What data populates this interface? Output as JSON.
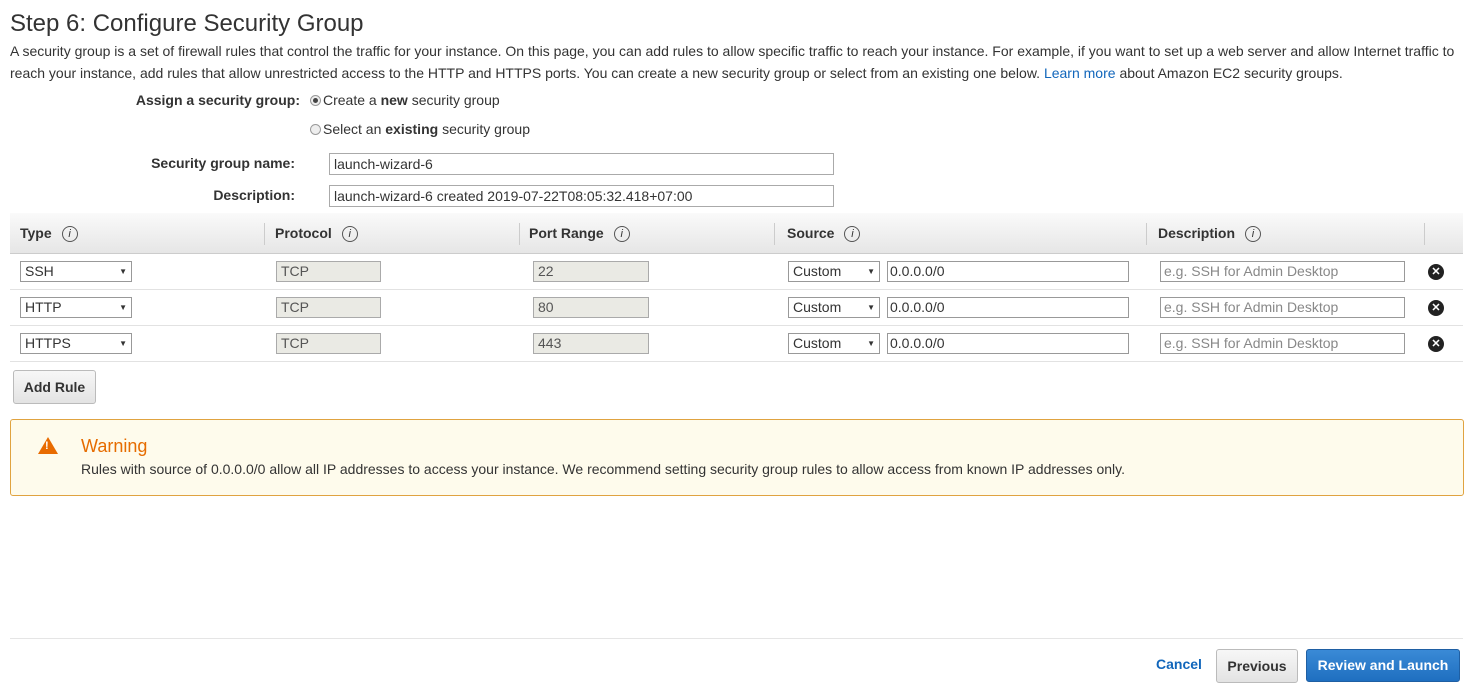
{
  "page": {
    "title": "Step 6: Configure Security Group",
    "intro_text": "A security group is a set of firewall rules that control the traffic for your instance. On this page, you can add rules to allow specific traffic to reach your instance. For example, if you want to set up a web server and allow Internet traffic to reach your instance, add rules that allow unrestricted access to the HTTP and HTTPS ports. You can create a new security group or select from an existing one below.",
    "learn_more": "Learn more",
    "intro_suffix": "about Amazon EC2 security groups."
  },
  "assign": {
    "label": "Assign a security group:",
    "option_new_pre": "Create a",
    "option_new_bold": "new",
    "option_new_post": "security group",
    "option_existing_pre": "Select an",
    "option_existing_bold": "existing",
    "option_existing_post": "security group",
    "selected": "new"
  },
  "group": {
    "name_label": "Security group name:",
    "name_value": "launch-wizard-6",
    "desc_label": "Description:",
    "desc_value": "launch-wizard-6 created 2019-07-22T08:05:32.418+07:00"
  },
  "table": {
    "headers": [
      "Type",
      "Protocol",
      "Port Range",
      "Source",
      "Description"
    ],
    "info_glyph": "i",
    "rows": [
      {
        "type": "SSH",
        "protocol": "TCP",
        "port": "22",
        "source_mode": "Custom",
        "source_cidr": "0.0.0.0/0",
        "desc_placeholder": "e.g. SSH for Admin Desktop"
      },
      {
        "type": "HTTP",
        "protocol": "TCP",
        "port": "80",
        "source_mode": "Custom",
        "source_cidr": "0.0.0.0/0",
        "desc_placeholder": "e.g. SSH for Admin Desktop"
      },
      {
        "type": "HTTPS",
        "protocol": "TCP",
        "port": "443",
        "source_mode": "Custom",
        "source_cidr": "0.0.0.0/0",
        "desc_placeholder": "e.g. SSH for Admin Desktop"
      }
    ],
    "caret": "▼",
    "delete_glyph": "✕"
  },
  "actions": {
    "add_rule": "Add Rule",
    "cancel": "Cancel",
    "previous": "Previous",
    "review": "Review and Launch"
  },
  "warning": {
    "icon_glyph": "!",
    "title": "Warning",
    "text": "Rules with source of 0.0.0.0/0 allow all IP addresses to access your instance. We recommend setting security group rules to allow access from known IP addresses only."
  },
  "colors": {
    "accent": "#1166bb",
    "primary_button": "#2a7ccc",
    "warning_border": "#e0a340",
    "warning_title": "#e66c00",
    "warning_bg": "#fefbec"
  },
  "icons": {
    "info": "info-icon",
    "delete": "close-circle-icon",
    "warning": "warning-triangle-icon",
    "caret": "chevron-down-icon",
    "radio": "radio-icon"
  }
}
